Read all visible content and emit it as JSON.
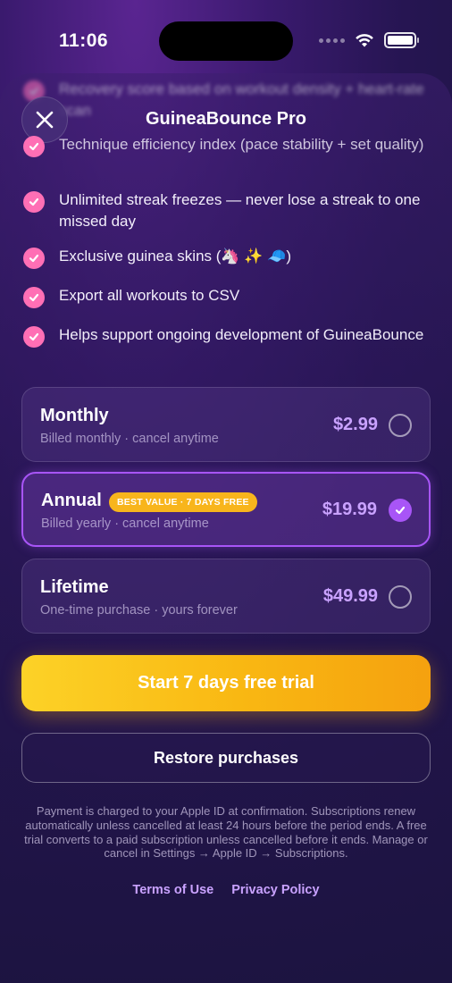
{
  "status_bar": {
    "time": "11:06"
  },
  "header": {
    "title": "GuineaBounce Pro"
  },
  "features_blurred": "Recovery score based on workout density + heart-rate scan",
  "features": [
    {
      "text": "Technique efficiency index (pace stability + set quality)"
    },
    {
      "text": "Unlimited streak freezes — never lose a streak to one missed day"
    },
    {
      "text": "Exclusive guinea skins (🦄 ✨ 🧢)"
    },
    {
      "text": "Export all workouts to CSV"
    },
    {
      "text": "Helps support ongoing development of GuineaBounce"
    }
  ],
  "plans": [
    {
      "name": "Monthly",
      "subtitle": "Billed monthly · cancel anytime",
      "price": "$2.99",
      "selected": false
    },
    {
      "name": "Annual",
      "subtitle": "Billed yearly · cancel anytime",
      "price": "$19.99",
      "badge": "BEST VALUE · 7 DAYS FREE",
      "selected": true
    },
    {
      "name": "Lifetime",
      "subtitle": "One-time purchase · yours forever",
      "price": "$49.99",
      "selected": false
    }
  ],
  "cta_label": "Start 7 days free trial",
  "restore_label": "Restore purchases",
  "legal_text": "Payment is charged to your Apple ID at confirmation. Subscriptions renew automatically unless cancelled at least 24 hours before the period ends. A free trial converts to a paid subscription unless cancelled before it ends. Manage or cancel in Settings → Apple ID → Subscriptions.",
  "links": {
    "terms": "Terms of Use",
    "privacy": "Privacy Policy"
  },
  "colors": {
    "accent": "#a855f7",
    "check": "#ff6fb5",
    "cta": "#f9b712",
    "badge": "#f8b51c",
    "price": "#c9a2ff"
  },
  "icons": {
    "close": "close-icon",
    "check": "checkmark-icon",
    "wifi": "wifi-icon",
    "battery": "battery-icon"
  }
}
